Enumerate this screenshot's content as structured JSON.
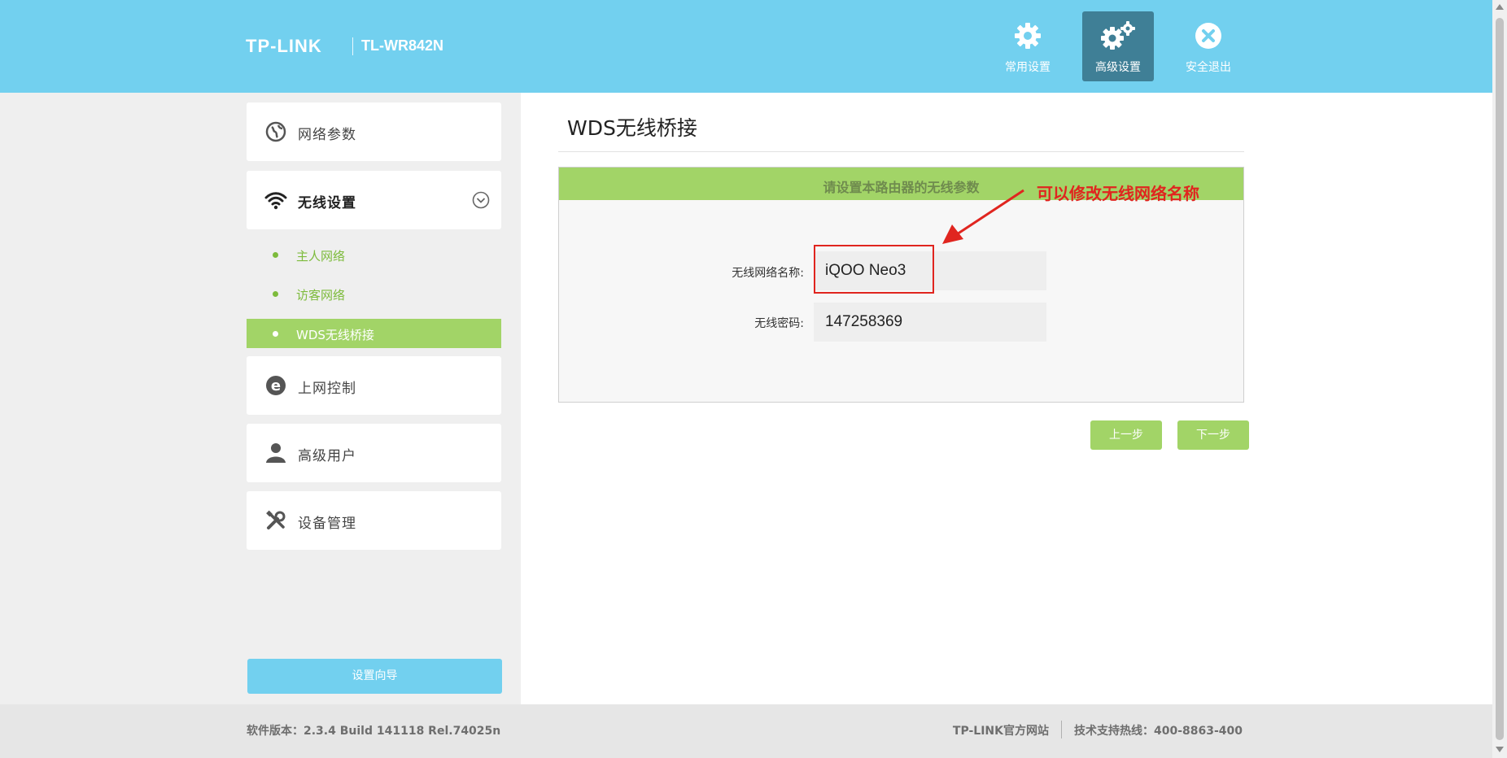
{
  "header": {
    "brand": "TP-LINK",
    "model": "TL-WR842N",
    "buttons": [
      {
        "label": "常用设置",
        "icon": "gear-icon"
      },
      {
        "label": "高级设置",
        "icon": "gears-icon",
        "active": true
      },
      {
        "label": "安全退出",
        "icon": "close-circle-icon"
      }
    ]
  },
  "sidebar": {
    "menu": [
      {
        "label": "网络参数",
        "icon": "globe-icon"
      },
      {
        "label": "无线设置",
        "icon": "wifi-icon",
        "expanded": true
      },
      {
        "label": "上网控制",
        "icon": "ie-icon"
      },
      {
        "label": "高级用户",
        "icon": "user-icon"
      },
      {
        "label": "设备管理",
        "icon": "tools-icon"
      }
    ],
    "submenu": [
      {
        "label": "主人网络"
      },
      {
        "label": "访客网络"
      },
      {
        "label": "WDS无线桥接",
        "active": true
      }
    ],
    "wizard_label": "设置向导"
  },
  "main": {
    "title": "WDS无线桥接",
    "panel_header": "请设置本路由器的无线参数",
    "annotation": "可以修改无线网络名称",
    "fields": [
      {
        "label": "无线网络名称:",
        "value": "iQOO Neo3"
      },
      {
        "label": "无线密码:",
        "value": "147258369"
      }
    ],
    "prev_label": "上一步",
    "next_label": "下一步"
  },
  "footer": {
    "version": "软件版本：2.3.4 Build 141118 Rel.74025n",
    "site": "TP-LINK官方网站",
    "hotline": "技术支持热线：400-8863-400"
  },
  "colors": {
    "header_bg": "#72d0ef",
    "accent_green": "#a2d467",
    "annotation_red": "#e0251f"
  }
}
